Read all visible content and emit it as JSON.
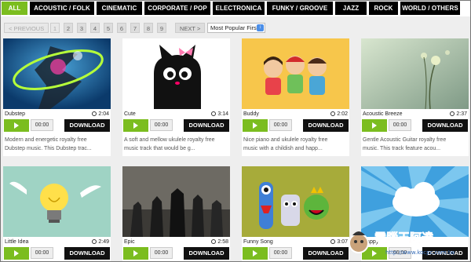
{
  "categories": [
    "ALL",
    "ACOUSTIC / FOLK",
    "CINEMATIC",
    "CORPORATE / POP",
    "ELECTRONICA",
    "FUNKY / GROOVE",
    "JAZZ",
    "ROCK",
    "WORLD / OTHERS"
  ],
  "active_category": "ALL",
  "pager": {
    "prev": "< PREVIOUS",
    "pages": [
      "1",
      "2",
      "3",
      "4",
      "5",
      "6",
      "7",
      "8",
      "9"
    ],
    "next": "NEXT >",
    "sort_value": "Most Popular First"
  },
  "tracks": [
    {
      "title": "Dubstep",
      "duration": "2:04",
      "time": "00:00",
      "download": "DOWNLOAD",
      "desc1": "Modern and energetic royalty free",
      "desc2": "Dubstep music. This Dubstep trac..."
    },
    {
      "title": "Cute",
      "duration": "3:14",
      "time": "00:00",
      "download": "DOWNLOAD",
      "desc1": "A soft and mellow ukulele royalty free",
      "desc2": "music track that would be g..."
    },
    {
      "title": "Buddy",
      "duration": "2:02",
      "time": "00:00",
      "download": "DOWNLOAD",
      "desc1": "Nice piano and ukulele royalty free",
      "desc2": "music with a childish and happ..."
    },
    {
      "title": "Acoustic Breeze",
      "duration": "2:37",
      "time": "00:00",
      "download": "DOWNLOAD",
      "desc1": "Gentle Acoustic Guitar royalty free",
      "desc2": "music. This track feature acou..."
    },
    {
      "title": "Little Idea",
      "duration": "2:49",
      "time": "00:00",
      "download": "DOWNLOAD",
      "desc1": "",
      "desc2": ""
    },
    {
      "title": "Epic",
      "duration": "2:58",
      "time": "00:00",
      "download": "DOWNLOAD",
      "desc1": "",
      "desc2": ""
    },
    {
      "title": "Funny Song",
      "duration": "3:07",
      "time": "00:00",
      "download": "DOWNLOAD",
      "desc1": "",
      "desc2": ""
    },
    {
      "title": "Happy",
      "duration": "",
      "time": "00:00",
      "download": "DOWNLOAD",
      "desc1": "",
      "desc2": ""
    }
  ],
  "watermark": {
    "text": "電腦王阿達",
    "url": "http://www.kocpc.com.tw"
  }
}
